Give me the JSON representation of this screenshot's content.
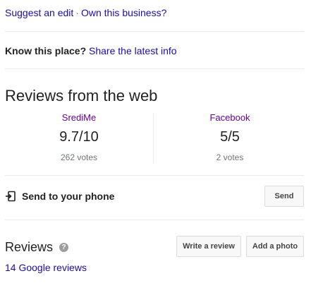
{
  "top_links": {
    "suggest_edit": "Suggest an edit",
    "separator": "·",
    "own_business": "Own this business?"
  },
  "know_place": {
    "prompt": "Know this place?",
    "link": "Share the latest info"
  },
  "reviews_from_web": {
    "title": "Reviews from the web",
    "sources": [
      {
        "name": "SrediMe",
        "score": "9.7/10",
        "votes": "262 votes"
      },
      {
        "name": "Facebook",
        "score": "5/5",
        "votes": "2 votes"
      }
    ]
  },
  "send_to_phone": {
    "label": "Send to your phone",
    "button": "Send",
    "icon": "send-to-phone-icon"
  },
  "reviews": {
    "title": "Reviews",
    "help_glyph": "?",
    "write_button": "Write a review",
    "photo_button": "Add a photo",
    "google_reviews_link": "14 Google reviews"
  },
  "colors": {
    "link": "#1a0dab",
    "visited_link": "#660099",
    "muted": "#70757a",
    "divider": "#ebebeb"
  }
}
